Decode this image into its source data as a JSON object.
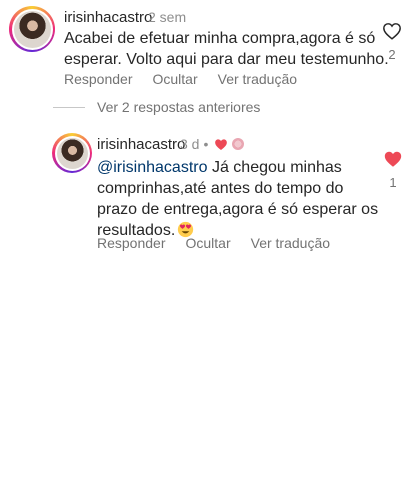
{
  "comment1": {
    "username": "irisinhacastro",
    "time": "2 sem",
    "text_line1": "Acabei de efetuar minha compra,agora é só",
    "text_line2": "esperar. Volto aqui para dar meu testemunho.",
    "actions": {
      "reply": "Responder",
      "hide": "Ocultar",
      "translate": "Ver tradução"
    },
    "likes": "2"
  },
  "view_previous": "Ver 2 respostas anteriores",
  "reply1": {
    "username": "irisinhacastro",
    "time": "3 d",
    "separator": "•",
    "mention": "@irisinhacastro",
    "text_line1": " Já chegou minhas",
    "text_line2": "comprinhas,até antes do tempo do",
    "text_line3": "prazo de entrega,agora é só esperar os",
    "text_line4": "resultados.",
    "actions": {
      "reply": "Responder",
      "hide": "Ocultar",
      "translate": "Ver tradução"
    },
    "likes": "1"
  },
  "colors": {
    "like_red": "#ed4956",
    "mention_blue": "#00376b",
    "muted": "#737373"
  },
  "icons": [
    "heart-outline-icon",
    "heart-filled-icon",
    "heart-eyes-emoji",
    "creator-liked-heart-icon",
    "avatar"
  ]
}
